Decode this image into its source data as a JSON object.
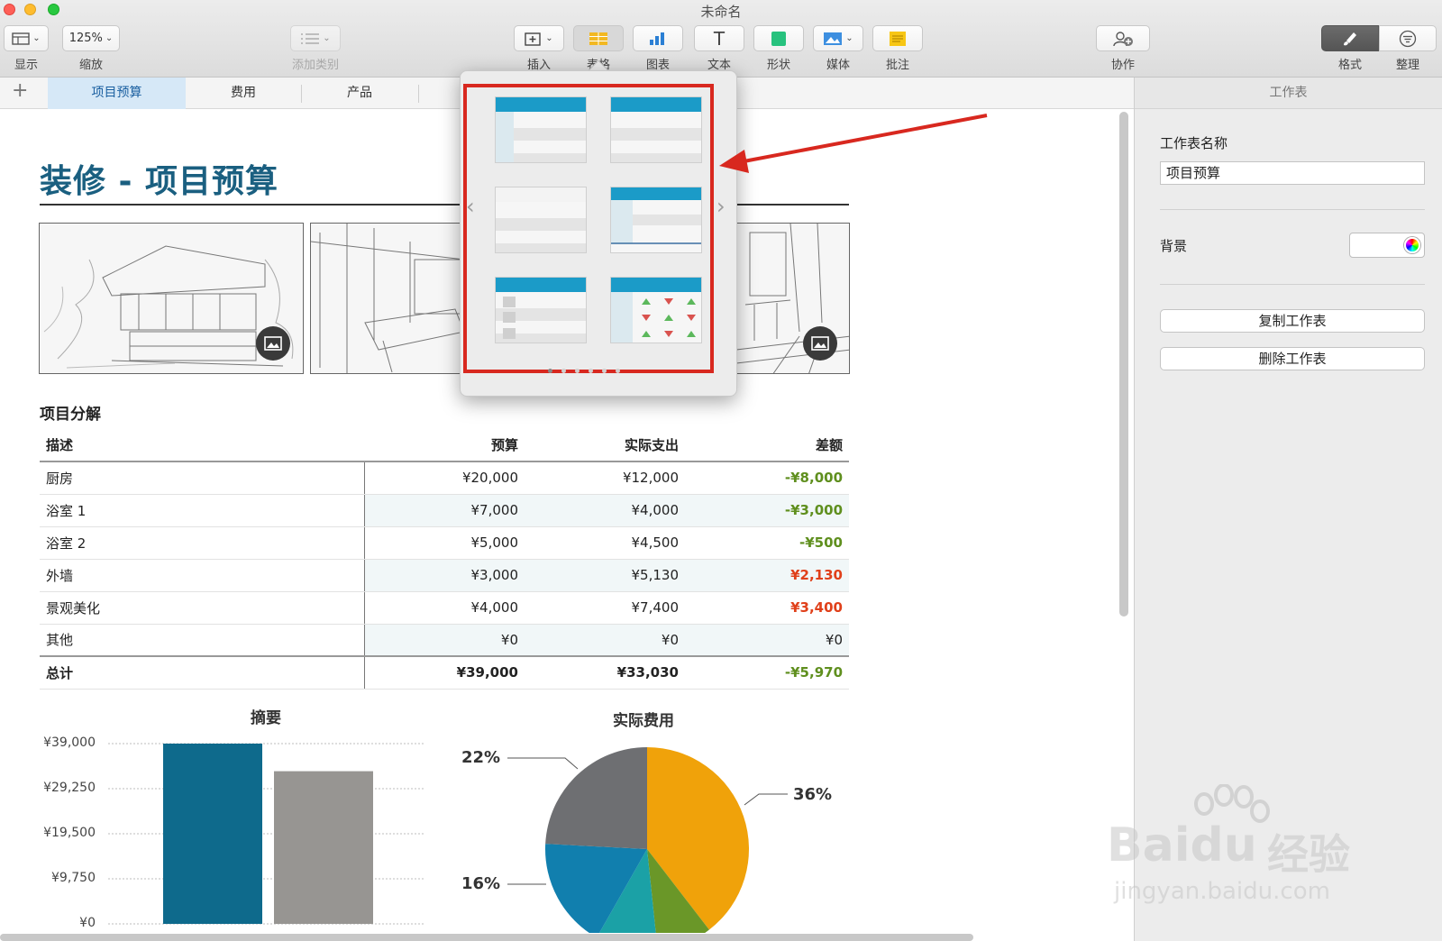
{
  "window": {
    "title": "未命名"
  },
  "toolbar": {
    "view_label": "显示",
    "zoom_value": "125%",
    "zoom_label": "缩放",
    "category_label": "添加类别",
    "insert_label": "插入",
    "table_label": "表格",
    "chart_label": "图表",
    "text_label": "文本",
    "shape_label": "形状",
    "media_label": "媒体",
    "comment_label": "批注",
    "collab_label": "协作",
    "format_label": "格式",
    "organize_label": "整理"
  },
  "sheet_tabs": [
    {
      "label": "项目预算",
      "active": true
    },
    {
      "label": "费用",
      "active": false
    },
    {
      "label": "产品",
      "active": false
    }
  ],
  "document": {
    "title": "装修 - 项目预算",
    "section_title": "项目分解",
    "table": {
      "headers": [
        "描述",
        "预算",
        "实际支出",
        "差额"
      ],
      "rows": [
        {
          "desc": "厨房",
          "budget": "¥20,000",
          "actual": "¥12,000",
          "diff": "-¥8,000",
          "tone": "neg"
        },
        {
          "desc": "浴室 1",
          "budget": "¥7,000",
          "actual": "¥4,000",
          "diff": "-¥3,000",
          "tone": "neg"
        },
        {
          "desc": "浴室 2",
          "budget": "¥5,000",
          "actual": "¥4,500",
          "diff": "-¥500",
          "tone": "neg"
        },
        {
          "desc": "外墙",
          "budget": "¥3,000",
          "actual": "¥5,130",
          "diff": "¥2,130",
          "tone": "pos"
        },
        {
          "desc": "景观美化",
          "budget": "¥4,000",
          "actual": "¥7,400",
          "diff": "¥3,400",
          "tone": "pos"
        },
        {
          "desc": "其他",
          "budget": "¥0",
          "actual": "¥0",
          "diff": "¥0",
          "tone": "zero"
        }
      ],
      "total": {
        "desc": "总计",
        "budget": "¥39,000",
        "actual": "¥33,030",
        "diff": "-¥5,970"
      }
    }
  },
  "chart_data": [
    {
      "type": "bar",
      "title": "摘要",
      "categories": [
        "",
        ""
      ],
      "series": [
        {
          "values": [
            39000,
            33030
          ]
        }
      ],
      "bar_colors": [
        "#0e6a8c",
        "#979592"
      ],
      "yticks": [
        "¥39,000",
        "¥29,250",
        "¥19,500",
        "¥9,750",
        "¥0"
      ],
      "ylim": [
        0,
        39000
      ],
      "grid": true
    },
    {
      "type": "pie",
      "title": "实际费用",
      "slices": [
        {
          "value": 36,
          "color": "#f0a20a"
        },
        {
          "value": 8,
          "color": "#6a9728"
        },
        {
          "value": 9,
          "color": "#1ba1a6"
        },
        {
          "value": 16,
          "color": "#117fae"
        },
        {
          "value": 22,
          "color": "#6e6f72"
        }
      ],
      "labels": [
        "36%",
        "16%",
        "22%"
      ]
    }
  ],
  "popover": {
    "styles_count": 6,
    "pages": 6,
    "current_page": 1
  },
  "inspector": {
    "header": "工作表",
    "sheet_name_label": "工作表名称",
    "sheet_name_value": "项目预算",
    "background_label": "背景",
    "duplicate_button": "复制工作表",
    "delete_button": "删除工作表"
  },
  "watermark": {
    "brand": "Baidu",
    "cn": "经验",
    "url": "jingyan.baidu.com"
  },
  "colors": {
    "accent": "#1a5f80",
    "highlight": "#d8281f",
    "negative": "#5f8f1e",
    "positive": "#e0401a"
  }
}
